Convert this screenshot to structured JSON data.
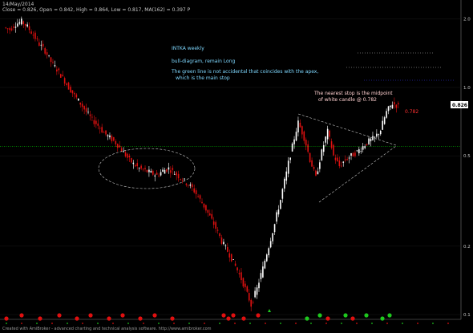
{
  "header": {
    "date": "14/May/2014",
    "ohlc": "Close = 0.826,   Open = 0.842,   High = 0.864,   Low = 0.817,  MA(162) =    0.397   P"
  },
  "annotations": {
    "line1": "INTKA weekly",
    "line2": "bull-diagram, remain Long",
    "line3": "The green line is not accidental that coincides with the apex,",
    "line4": "which is the main stop",
    "stop1": "The nearest stop is the midpoint",
    "stop2": "of white candle @ 0.782"
  },
  "price_label": "0.826",
  "stop_label": "0.782",
  "footer": "Created with AmiBroker - advanced charting and technical analysis software. http://www.amibroker.com",
  "colors": {
    "background": "#000000",
    "bull_candle": "#ffffff",
    "bear_candle": "#e01010",
    "support_line": "#00c000",
    "triangle_lines": "#c8c8c8",
    "marker_green": "#1ec81e",
    "marker_red": "#e01010"
  },
  "chart_data": {
    "type": "candlestick",
    "title": "INTKA weekly",
    "y_scale": "log",
    "ylim": [
      0.1,
      2.2
    ],
    "y_ticks": [
      "2.0",
      "1.0",
      "0.5",
      "0.2",
      "0.1"
    ],
    "y_tick_values": [
      2.0,
      1.0,
      0.5,
      0.2,
      0.1
    ],
    "horizontal_line": {
      "value": 0.55,
      "color": "green",
      "style": "dotted"
    },
    "last_close": 0.826,
    "stop_level": 0.782,
    "series": [
      {
        "name": "weekly",
        "close": [
          1.8,
          1.9,
          1.95,
          1.85,
          1.7,
          1.55,
          1.45,
          1.3,
          1.2,
          1.1,
          1.0,
          0.92,
          0.85,
          0.78,
          0.72,
          0.68,
          0.63,
          0.6,
          0.57,
          0.53,
          0.49,
          0.46,
          0.44,
          0.43,
          0.42,
          0.41,
          0.43,
          0.44,
          0.42,
          0.4,
          0.38,
          0.36,
          0.33,
          0.3,
          0.27,
          0.24,
          0.21,
          0.19,
          0.17,
          0.15,
          0.13,
          0.11,
          0.13,
          0.16,
          0.2,
          0.25,
          0.32,
          0.42,
          0.55,
          0.7,
          0.6,
          0.48,
          0.4,
          0.52,
          0.64,
          0.5,
          0.45,
          0.48,
          0.5,
          0.52,
          0.55,
          0.58,
          0.6,
          0.65,
          0.78,
          0.85,
          0.826
        ]
      }
    ]
  }
}
